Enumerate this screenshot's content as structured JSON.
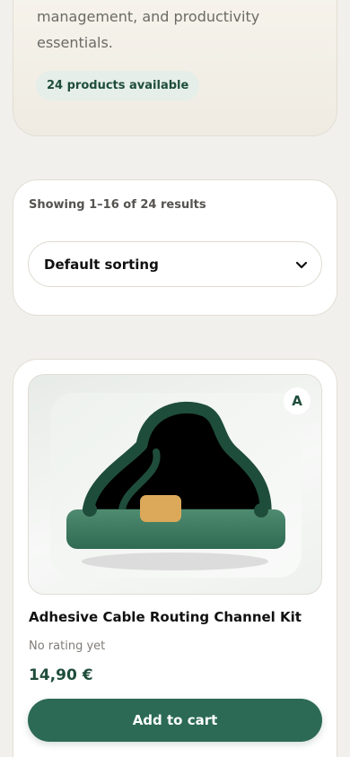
{
  "category_intro": {
    "description_fragment": "management, and productivity essentials.",
    "products_count_label": "24 products available"
  },
  "toolbar": {
    "results_text": "Showing 1–16 of 24 results",
    "sort_selected": "Default sorting"
  },
  "product": {
    "badge": "A",
    "name": "Adhesive Cable Routing Channel Kit",
    "rating_text": "No rating yet",
    "price": "14,90 €",
    "add_to_cart_label": "Add to cart",
    "image_icon": "beanie-hat-illustration"
  },
  "colors": {
    "accent": "#2c6a55",
    "accent_dark": "#1f4d3b",
    "background": "#f2f0ec",
    "card": "#ffffff"
  }
}
